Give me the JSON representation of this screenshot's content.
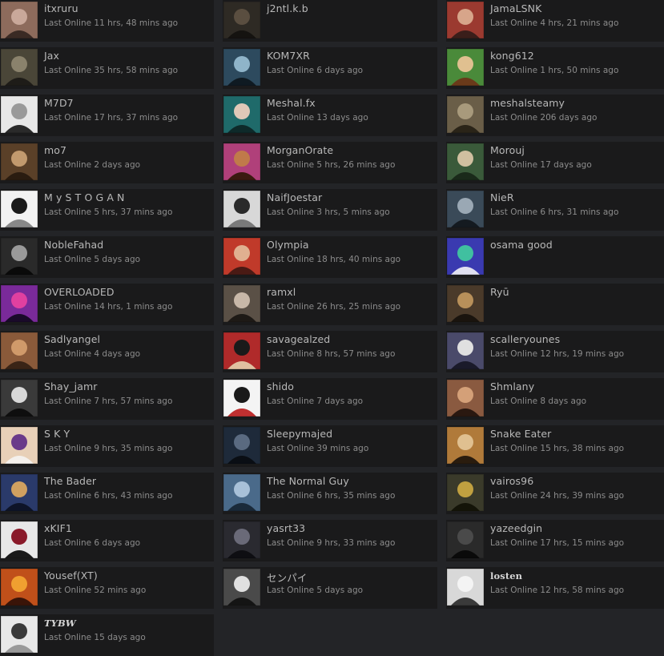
{
  "friends": [
    {
      "name": "itxruru",
      "status": "Last Online 11 hrs, 48 mins ago",
      "avatar": [
        "#8d6b5c",
        "#c9a89a",
        "#3a2a24"
      ]
    },
    {
      "name": "j2ntl.k.b",
      "status": "",
      "avatar": [
        "#2e2a24",
        "#5a4e40",
        "#151310"
      ]
    },
    {
      "name": "JamaLSNK",
      "status": "Last Online 4 hrs, 21 mins ago",
      "avatar": [
        "#9b3a30",
        "#d7a58a",
        "#3a1e1a"
      ]
    },
    {
      "name": "Jax",
      "status": "Last Online 35 hrs, 58 mins ago",
      "avatar": [
        "#4a4638",
        "#8a826c",
        "#1e1c18"
      ]
    },
    {
      "name": "KOM7XR",
      "status": "Last Online 6 days ago",
      "avatar": [
        "#2d4a5e",
        "#8fb4c9",
        "#0f1a22"
      ]
    },
    {
      "name": "kong612",
      "status": "Last Online 1 hrs, 50 mins ago",
      "avatar": [
        "#4a8a3a",
        "#e0c090",
        "#6a3a1a"
      ]
    },
    {
      "name": "M7D7",
      "status": "Last Online 17 hrs, 37 mins ago",
      "avatar": [
        "#e8e8e8",
        "#9a9a9a",
        "#2a2a2a"
      ]
    },
    {
      "name": "Meshal.fx",
      "status": "Last Online 13 days ago",
      "avatar": [
        "#1f6a6a",
        "#e0c8b8",
        "#0e2a2a"
      ]
    },
    {
      "name": "meshalsteamy",
      "status": "Last Online 206 days ago",
      "avatar": [
        "#6a5e48",
        "#a89a7c",
        "#2a2418"
      ]
    },
    {
      "name": "mo7",
      "status": "Last Online 2 days ago",
      "avatar": [
        "#5a4028",
        "#c29a6e",
        "#2a1c10"
      ]
    },
    {
      "name": "MorganOrate",
      "status": "Last Online 5 hrs, 26 mins ago",
      "avatar": [
        "#b0407a",
        "#c07a4a",
        "#3a1a10"
      ]
    },
    {
      "name": "Morouj",
      "status": "Last Online 17 days ago",
      "avatar": [
        "#3a5a3a",
        "#d0c0a0",
        "#1a2a1a"
      ]
    },
    {
      "name": "M y S T O G A N",
      "status": "Last Online 5 hrs, 37 mins ago",
      "avatar": [
        "#f2f2f2",
        "#1a1a1a",
        "#888888"
      ]
    },
    {
      "name": "NaifJoestar",
      "status": "Last Online 3 hrs, 5 mins ago",
      "avatar": [
        "#d8d8d8",
        "#2a2a2a",
        "#7a7a7a"
      ]
    },
    {
      "name": "NieR",
      "status": "Last Online 6 hrs, 31 mins ago",
      "avatar": [
        "#3a4a58",
        "#9aa8b4",
        "#141a20"
      ]
    },
    {
      "name": "NobleFahad",
      "status": "Last Online 5 days ago",
      "avatar": [
        "#2a2a2a",
        "#9a9a9a",
        "#0a0a0a"
      ]
    },
    {
      "name": "Olympia",
      "status": "Last Online 18 hrs, 40 mins ago",
      "avatar": [
        "#c03a2a",
        "#e0b090",
        "#4a1a14"
      ]
    },
    {
      "name": "osama good",
      "status": "",
      "avatar": [
        "#3a3ab0",
        "#40c0a0",
        "#e0e0f0"
      ]
    },
    {
      "name": "OVERLOADED",
      "status": "Last Online 14 hrs, 1 mins ago",
      "avatar": [
        "#7a2a9a",
        "#e040a0",
        "#1a0a2a"
      ]
    },
    {
      "name": "ramxl",
      "status": "Last Online 26 hrs, 25 mins ago",
      "avatar": [
        "#5a5046",
        "#c8b8a8",
        "#1e1a16"
      ]
    },
    {
      "name": "Ryū",
      "status": "",
      "avatar": [
        "#4a3a2a",
        "#b8905a",
        "#1a140e"
      ]
    },
    {
      "name": "Sadlyangel",
      "status": "Last Online 4 days ago",
      "avatar": [
        "#8a5a3a",
        "#d09a6a",
        "#3a2416"
      ]
    },
    {
      "name": "savagealzed",
      "status": "Last Online 8 hrs, 57 mins ago",
      "avatar": [
        "#b02a2a",
        "#1a1a1a",
        "#e0c0a0"
      ]
    },
    {
      "name": "scalleryounes",
      "status": "Last Online 12 hrs, 19 mins ago",
      "avatar": [
        "#4a4a6a",
        "#e0e0e0",
        "#1a1a2a"
      ]
    },
    {
      "name": "Shay_jamr",
      "status": "Last Online 7 hrs, 57 mins ago",
      "avatar": [
        "#3a3a3a",
        "#d8d8d8",
        "#0e0e0e"
      ]
    },
    {
      "name": "shido",
      "status": "Last Online 7 days ago",
      "avatar": [
        "#f4f4f4",
        "#1a1a1a",
        "#c03030"
      ]
    },
    {
      "name": "Shmlany",
      "status": "Last Online 8 days ago",
      "avatar": [
        "#8a5a40",
        "#d4a078",
        "#2a1810"
      ]
    },
    {
      "name": "S K Y",
      "status": "Last Online 9 hrs, 35 mins ago",
      "avatar": [
        "#e8d0b8",
        "#6a3a8a",
        "#f4f0ec"
      ]
    },
    {
      "name": "Sleepymajed",
      "status": "Last Online 39 mins ago",
      "avatar": [
        "#1e2a3a",
        "#5a6a80",
        "#0a0e14"
      ]
    },
    {
      "name": "Snake Eater",
      "status": "Last Online 15 hrs, 38 mins ago",
      "avatar": [
        "#b07a3a",
        "#e0c090",
        "#2a1c0e"
      ]
    },
    {
      "name": "The Bader",
      "status": "Last Online 6 hrs, 43 mins ago",
      "avatar": [
        "#2a3a6a",
        "#d0a060",
        "#0e1428"
      ]
    },
    {
      "name": "The Normal Guy",
      "status": "Last Online 6 hrs, 35 mins ago",
      "avatar": [
        "#4a6a8a",
        "#a8c0d8",
        "#1a2a3a"
      ]
    },
    {
      "name": "vairos96",
      "status": "Last Online 24 hrs, 39 mins ago",
      "avatar": [
        "#3a3a2a",
        "#c0a040",
        "#141408"
      ]
    },
    {
      "name": "xKIF1",
      "status": "Last Online 6 days ago",
      "avatar": [
        "#e8e8e8",
        "#8a1a2a",
        "#1a1a1a"
      ]
    },
    {
      "name": "yasrt33",
      "status": "Last Online 9 hrs, 33 mins ago",
      "avatar": [
        "#2a2a30",
        "#6a6a78",
        "#0e0e12"
      ]
    },
    {
      "name": "yazeedgin",
      "status": "Last Online 17 hrs, 15 mins ago",
      "avatar": [
        "#2a2a2a",
        "#4a4a4a",
        "#0a0a0a"
      ]
    },
    {
      "name": "Yousef(XT)",
      "status": "Last Online 52 mins ago",
      "avatar": [
        "#c0501a",
        "#f0a030",
        "#3a1408"
      ]
    },
    {
      "name": "センパイ",
      "status": "Last Online 5 days ago",
      "avatar": [
        "#4a4a4a",
        "#e0e0e0",
        "#141414"
      ]
    },
    {
      "name": "losten",
      "status": "Last Online 12 hrs, 58 mins ago",
      "avatar": [
        "#d8d8d8",
        "#f4f4f4",
        "#3a3a3a"
      ],
      "style": "serif"
    },
    {
      "name": "TYBW",
      "status": "Last Online 15 days ago",
      "avatar": [
        "#e8e8e8",
        "#3a3a3a",
        "#9a9a9a"
      ],
      "style": "serif-i"
    }
  ]
}
